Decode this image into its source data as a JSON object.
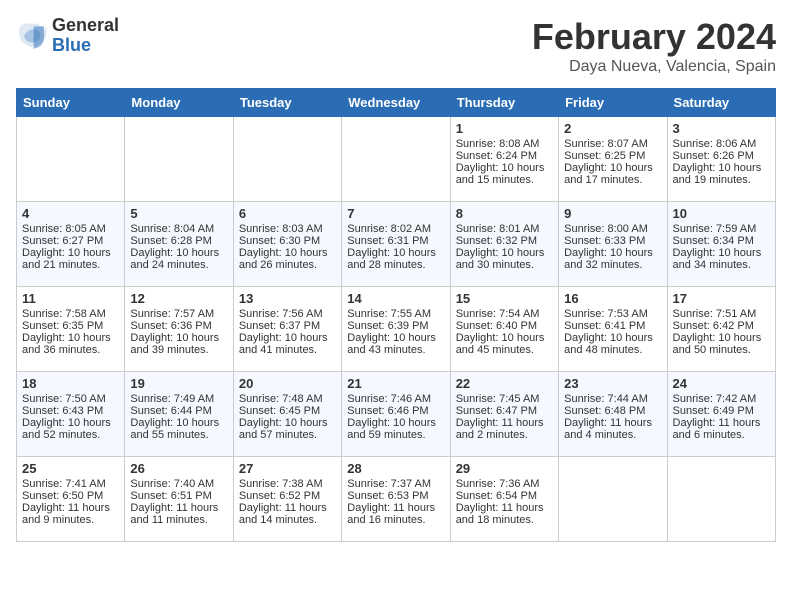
{
  "header": {
    "logo_general": "General",
    "logo_blue": "Blue",
    "title": "February 2024",
    "subtitle": "Daya Nueva, Valencia, Spain"
  },
  "days_of_week": [
    "Sunday",
    "Monday",
    "Tuesday",
    "Wednesday",
    "Thursday",
    "Friday",
    "Saturday"
  ],
  "weeks": [
    [
      {
        "day": "",
        "empty": true
      },
      {
        "day": "",
        "empty": true
      },
      {
        "day": "",
        "empty": true
      },
      {
        "day": "",
        "empty": true
      },
      {
        "day": "1",
        "sunrise": "8:08 AM",
        "sunset": "6:24 PM",
        "daylight": "10 hours and 15 minutes."
      },
      {
        "day": "2",
        "sunrise": "8:07 AM",
        "sunset": "6:25 PM",
        "daylight": "10 hours and 17 minutes."
      },
      {
        "day": "3",
        "sunrise": "8:06 AM",
        "sunset": "6:26 PM",
        "daylight": "10 hours and 19 minutes."
      }
    ],
    [
      {
        "day": "4",
        "sunrise": "8:05 AM",
        "sunset": "6:27 PM",
        "daylight": "10 hours and 21 minutes."
      },
      {
        "day": "5",
        "sunrise": "8:04 AM",
        "sunset": "6:28 PM",
        "daylight": "10 hours and 24 minutes."
      },
      {
        "day": "6",
        "sunrise": "8:03 AM",
        "sunset": "6:30 PM",
        "daylight": "10 hours and 26 minutes."
      },
      {
        "day": "7",
        "sunrise": "8:02 AM",
        "sunset": "6:31 PM",
        "daylight": "10 hours and 28 minutes."
      },
      {
        "day": "8",
        "sunrise": "8:01 AM",
        "sunset": "6:32 PM",
        "daylight": "10 hours and 30 minutes."
      },
      {
        "day": "9",
        "sunrise": "8:00 AM",
        "sunset": "6:33 PM",
        "daylight": "10 hours and 32 minutes."
      },
      {
        "day": "10",
        "sunrise": "7:59 AM",
        "sunset": "6:34 PM",
        "daylight": "10 hours and 34 minutes."
      }
    ],
    [
      {
        "day": "11",
        "sunrise": "7:58 AM",
        "sunset": "6:35 PM",
        "daylight": "10 hours and 36 minutes."
      },
      {
        "day": "12",
        "sunrise": "7:57 AM",
        "sunset": "6:36 PM",
        "daylight": "10 hours and 39 minutes."
      },
      {
        "day": "13",
        "sunrise": "7:56 AM",
        "sunset": "6:37 PM",
        "daylight": "10 hours and 41 minutes."
      },
      {
        "day": "14",
        "sunrise": "7:55 AM",
        "sunset": "6:39 PM",
        "daylight": "10 hours and 43 minutes."
      },
      {
        "day": "15",
        "sunrise": "7:54 AM",
        "sunset": "6:40 PM",
        "daylight": "10 hours and 45 minutes."
      },
      {
        "day": "16",
        "sunrise": "7:53 AM",
        "sunset": "6:41 PM",
        "daylight": "10 hours and 48 minutes."
      },
      {
        "day": "17",
        "sunrise": "7:51 AM",
        "sunset": "6:42 PM",
        "daylight": "10 hours and 50 minutes."
      }
    ],
    [
      {
        "day": "18",
        "sunrise": "7:50 AM",
        "sunset": "6:43 PM",
        "daylight": "10 hours and 52 minutes."
      },
      {
        "day": "19",
        "sunrise": "7:49 AM",
        "sunset": "6:44 PM",
        "daylight": "10 hours and 55 minutes."
      },
      {
        "day": "20",
        "sunrise": "7:48 AM",
        "sunset": "6:45 PM",
        "daylight": "10 hours and 57 minutes."
      },
      {
        "day": "21",
        "sunrise": "7:46 AM",
        "sunset": "6:46 PM",
        "daylight": "10 hours and 59 minutes."
      },
      {
        "day": "22",
        "sunrise": "7:45 AM",
        "sunset": "6:47 PM",
        "daylight": "11 hours and 2 minutes."
      },
      {
        "day": "23",
        "sunrise": "7:44 AM",
        "sunset": "6:48 PM",
        "daylight": "11 hours and 4 minutes."
      },
      {
        "day": "24",
        "sunrise": "7:42 AM",
        "sunset": "6:49 PM",
        "daylight": "11 hours and 6 minutes."
      }
    ],
    [
      {
        "day": "25",
        "sunrise": "7:41 AM",
        "sunset": "6:50 PM",
        "daylight": "11 hours and 9 minutes."
      },
      {
        "day": "26",
        "sunrise": "7:40 AM",
        "sunset": "6:51 PM",
        "daylight": "11 hours and 11 minutes."
      },
      {
        "day": "27",
        "sunrise": "7:38 AM",
        "sunset": "6:52 PM",
        "daylight": "11 hours and 14 minutes."
      },
      {
        "day": "28",
        "sunrise": "7:37 AM",
        "sunset": "6:53 PM",
        "daylight": "11 hours and 16 minutes."
      },
      {
        "day": "29",
        "sunrise": "7:36 AM",
        "sunset": "6:54 PM",
        "daylight": "11 hours and 18 minutes."
      },
      {
        "day": "",
        "empty": true
      },
      {
        "day": "",
        "empty": true
      }
    ]
  ],
  "labels": {
    "sunrise_prefix": "Sunrise: ",
    "sunset_prefix": "Sunset: ",
    "daylight_prefix": "Daylight: "
  }
}
